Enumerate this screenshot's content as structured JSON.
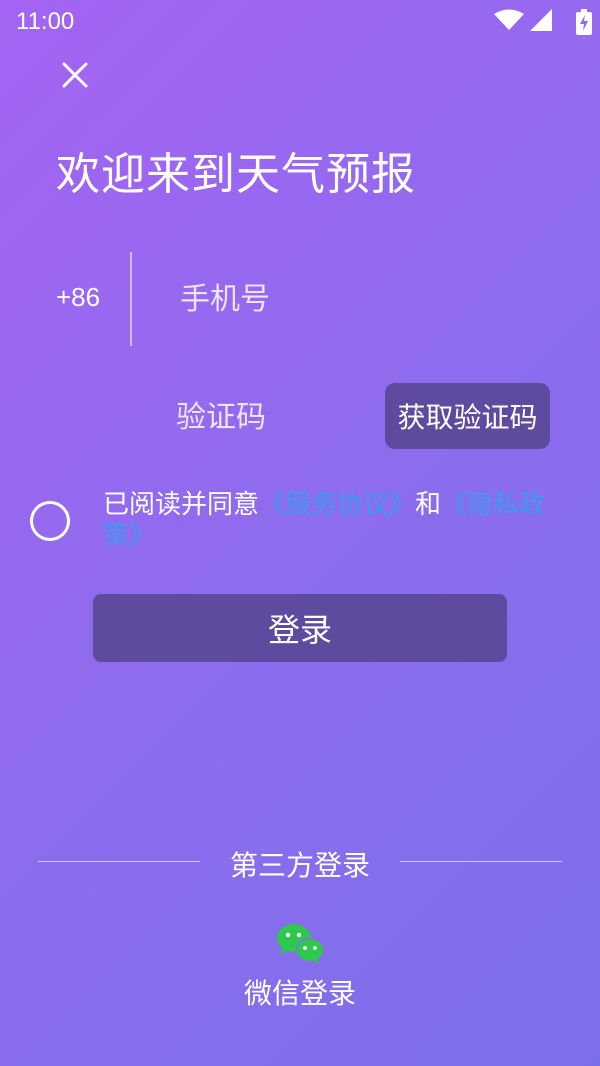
{
  "status_bar": {
    "time": "11:00",
    "icons": [
      "wifi-icon",
      "signal-icon",
      "battery-charging-icon"
    ]
  },
  "close_icon": "close-icon",
  "title": "欢迎来到天气预报",
  "phone": {
    "country_code": "+86",
    "placeholder": "手机号",
    "value": ""
  },
  "code": {
    "placeholder": "验证码",
    "value": "",
    "get_code_label": "获取验证码"
  },
  "agreement": {
    "checked": false,
    "prefix": "已阅读并同意",
    "service_link": "《服务协议》",
    "conjunction": "和",
    "privacy_link": "《隐私政策》"
  },
  "login_label": "登录",
  "third_party": {
    "label": "第三方登录",
    "wechat_label": "微信登录",
    "wechat_icon": "wechat-icon"
  },
  "colors": {
    "gradient_start": "#a463f2",
    "gradient_end": "#7b6fe9",
    "button_bg": "#5e4a9e",
    "link": "#3a9cf2",
    "wechat": "#2dc84d"
  }
}
